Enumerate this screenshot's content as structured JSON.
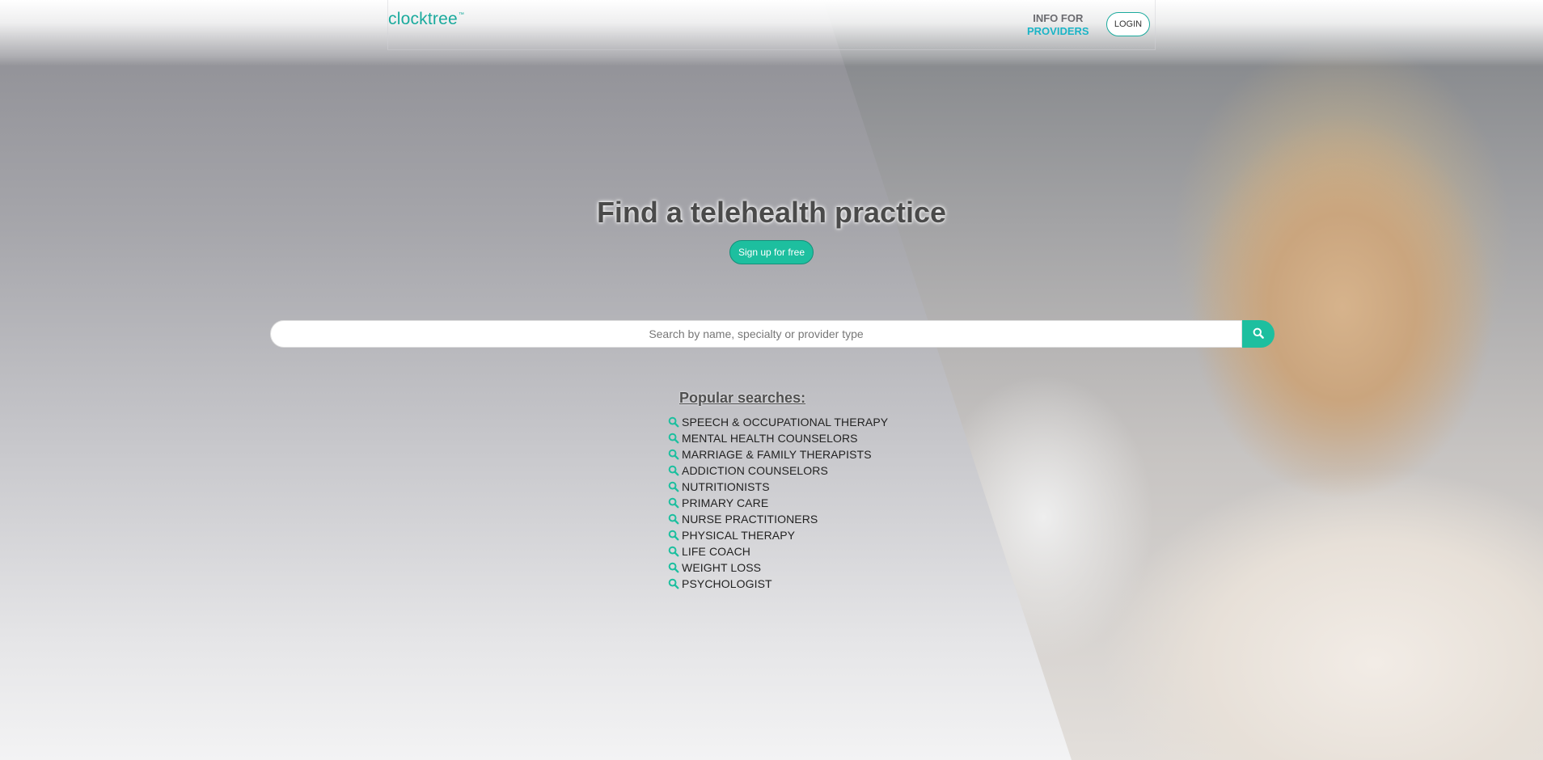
{
  "header": {
    "logo_text": "clocktree",
    "logo_mark": "™",
    "info_for_line1": "INFO FOR",
    "info_for_line2": "PROVIDERS",
    "login_label": "LOGIN"
  },
  "hero": {
    "title": "Find a telehealth practice",
    "signup_label": "Sign up for free"
  },
  "search": {
    "placeholder": "Search by name, specialty or provider type",
    "value": "",
    "button_icon": "search-icon"
  },
  "popular": {
    "heading": "Popular searches:",
    "items": [
      "SPEECH & OCCUPATIONAL THERAPY",
      "MENTAL HEALTH COUNSELORS",
      "MARRIAGE & FAMILY THERAPISTS",
      "ADDICTION COUNSELORS",
      "NUTRITIONISTS",
      "PRIMARY CARE",
      "NURSE PRACTITIONERS",
      "PHYSICAL THERAPY",
      "LIFE COACH",
      "WEIGHT LOSS",
      "PSYCHOLOGIST"
    ]
  },
  "colors": {
    "brand_teal": "#1aaa9d",
    "button_green": "#1dbf9f",
    "providers_blue": "#1ab4c6"
  }
}
